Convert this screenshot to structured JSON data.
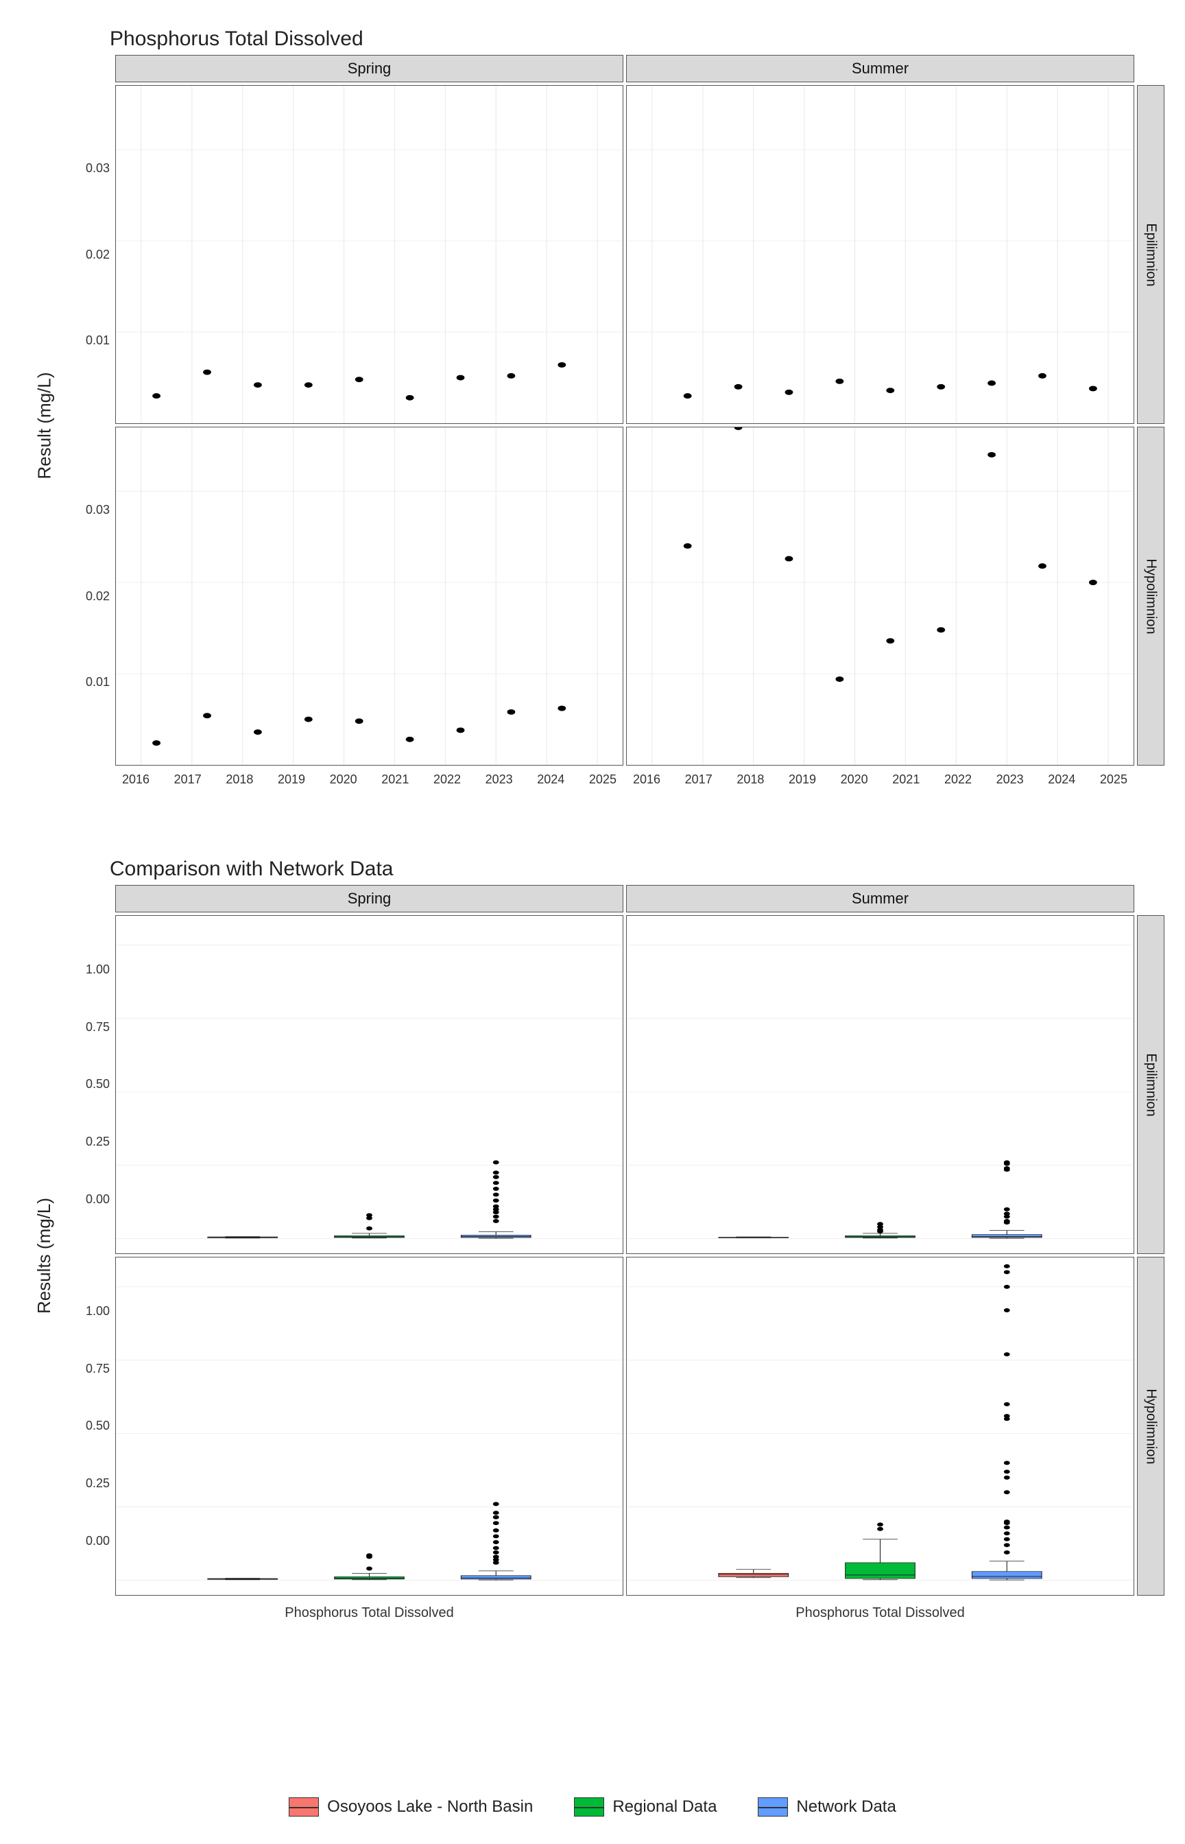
{
  "chart_data": [
    {
      "id": "scatter_grid",
      "type": "scatter",
      "title": "Phosphorus Total Dissolved",
      "ylabel": "Result (mg/L)",
      "xlabel": "",
      "x_range": [
        2015.5,
        2025.5
      ],
      "y_range": [
        0,
        0.037
      ],
      "x_ticks": [
        2016,
        2017,
        2018,
        2019,
        2020,
        2021,
        2022,
        2023,
        2024,
        2025
      ],
      "y_ticks": [
        0.01,
        0.02,
        0.03
      ],
      "facet_cols": [
        "Spring",
        "Summer"
      ],
      "facet_rows": [
        "Epilimnion",
        "Hypolimnion"
      ],
      "panels": {
        "Spring|Epilimnion": [
          {
            "x": 2016.3,
            "y": 0.003
          },
          {
            "x": 2017.3,
            "y": 0.0056
          },
          {
            "x": 2018.3,
            "y": 0.0042
          },
          {
            "x": 2019.3,
            "y": 0.0042
          },
          {
            "x": 2020.3,
            "y": 0.0048
          },
          {
            "x": 2021.3,
            "y": 0.0028
          },
          {
            "x": 2022.3,
            "y": 0.005
          },
          {
            "x": 2023.3,
            "y": 0.0052
          },
          {
            "x": 2024.3,
            "y": 0.0064
          }
        ],
        "Summer|Epilimnion": [
          {
            "x": 2016.7,
            "y": 0.003
          },
          {
            "x": 2017.7,
            "y": 0.004
          },
          {
            "x": 2018.7,
            "y": 0.0034
          },
          {
            "x": 2019.7,
            "y": 0.0046
          },
          {
            "x": 2020.7,
            "y": 0.0036
          },
          {
            "x": 2021.7,
            "y": 0.004
          },
          {
            "x": 2022.7,
            "y": 0.0044
          },
          {
            "x": 2023.7,
            "y": 0.0052
          },
          {
            "x": 2024.7,
            "y": 0.0038
          }
        ],
        "Spring|Hypolimnion": [
          {
            "x": 2016.3,
            "y": 0.0024
          },
          {
            "x": 2017.3,
            "y": 0.0054
          },
          {
            "x": 2018.3,
            "y": 0.0036
          },
          {
            "x": 2019.3,
            "y": 0.005
          },
          {
            "x": 2020.3,
            "y": 0.0048
          },
          {
            "x": 2021.3,
            "y": 0.0028
          },
          {
            "x": 2022.3,
            "y": 0.0038
          },
          {
            "x": 2023.3,
            "y": 0.0058
          },
          {
            "x": 2024.3,
            "y": 0.0062
          }
        ],
        "Summer|Hypolimnion": [
          {
            "x": 2016.7,
            "y": 0.024
          },
          {
            "x": 2017.7,
            "y": 0.037
          },
          {
            "x": 2018.7,
            "y": 0.0226
          },
          {
            "x": 2019.7,
            "y": 0.0094
          },
          {
            "x": 2020.7,
            "y": 0.0136
          },
          {
            "x": 2021.7,
            "y": 0.0148
          },
          {
            "x": 2022.7,
            "y": 0.034
          },
          {
            "x": 2023.7,
            "y": 0.0218
          },
          {
            "x": 2024.7,
            "y": 0.02
          }
        ]
      }
    },
    {
      "id": "box_grid",
      "type": "boxplot",
      "title": "Comparison with Network Data",
      "ylabel": "Results (mg/L)",
      "xlabel": "Phosphorus Total Dissolved",
      "y_range": [
        -0.05,
        1.1
      ],
      "y_ticks": [
        0.0,
        0.25,
        0.5,
        0.75,
        1.0
      ],
      "facet_cols": [
        "Spring",
        "Summer"
      ],
      "facet_rows": [
        "Epilimnion",
        "Hypolimnion"
      ],
      "groups": [
        "Osoyoos Lake - North Basin",
        "Regional Data",
        "Network Data"
      ],
      "group_colors": {
        "Osoyoos Lake - North Basin": "#f8766d",
        "Regional Data": "#00ba38",
        "Network Data": "#619cff"
      },
      "panels": {
        "Spring|Epilimnion": {
          "boxes": [
            {
              "g": "Osoyoos Lake - North Basin",
              "q1": 0.003,
              "med": 0.005,
              "q3": 0.006,
              "lw": 0.002,
              "uw": 0.007
            },
            {
              "g": "Regional Data",
              "q1": 0.004,
              "med": 0.006,
              "q3": 0.01,
              "lw": 0.002,
              "uw": 0.018
            },
            {
              "g": "Network Data",
              "q1": 0.004,
              "med": 0.007,
              "q3": 0.012,
              "lw": 0.001,
              "uw": 0.024
            }
          ],
          "outliers": {
            "Regional Data": [
              0.035,
              0.07,
              0.08
            ],
            "Network Data": [
              0.06,
              0.075,
              0.09,
              0.1,
              0.11,
              0.13,
              0.15,
              0.17,
              0.19,
              0.21,
              0.225,
              0.26
            ]
          }
        },
        "Summer|Epilimnion": {
          "boxes": [
            {
              "g": "Osoyoos Lake - North Basin",
              "q1": 0.003,
              "med": 0.004,
              "q3": 0.005,
              "lw": 0.003,
              "uw": 0.006
            },
            {
              "g": "Regional Data",
              "q1": 0.004,
              "med": 0.006,
              "q3": 0.01,
              "lw": 0.002,
              "uw": 0.018
            },
            {
              "g": "Network Data",
              "q1": 0.004,
              "med": 0.007,
              "q3": 0.014,
              "lw": 0.001,
              "uw": 0.028
            }
          ],
          "outliers": {
            "Regional Data": [
              0.025,
              0.03,
              0.04,
              0.05
            ],
            "Network Data": [
              0.055,
              0.06,
              0.075,
              0.085,
              0.1,
              0.235,
              0.24,
              0.255,
              0.26
            ]
          }
        },
        "Spring|Hypolimnion": {
          "boxes": [
            {
              "g": "Osoyoos Lake - North Basin",
              "q1": 0.003,
              "med": 0.005,
              "q3": 0.006,
              "lw": 0.002,
              "uw": 0.007
            },
            {
              "g": "Regional Data",
              "q1": 0.004,
              "med": 0.007,
              "q3": 0.012,
              "lw": 0.002,
              "uw": 0.024
            },
            {
              "g": "Network Data",
              "q1": 0.004,
              "med": 0.008,
              "q3": 0.016,
              "lw": 0.001,
              "uw": 0.032
            }
          ],
          "outliers": {
            "Regional Data": [
              0.04,
              0.08,
              0.085
            ],
            "Network Data": [
              0.06,
              0.07,
              0.08,
              0.095,
              0.11,
              0.13,
              0.15,
              0.17,
              0.195,
              0.215,
              0.23,
              0.26
            ]
          }
        },
        "Summer|Hypolimnion": {
          "boxes": [
            {
              "g": "Osoyoos Lake - North Basin",
              "q1": 0.012,
              "med": 0.02,
              "q3": 0.024,
              "lw": 0.009,
              "uw": 0.037
            },
            {
              "g": "Regional Data",
              "q1": 0.006,
              "med": 0.018,
              "q3": 0.06,
              "lw": 0.002,
              "uw": 0.14
            },
            {
              "g": "Network Data",
              "q1": 0.006,
              "med": 0.013,
              "q3": 0.03,
              "lw": 0.001,
              "uw": 0.065
            }
          ],
          "outliers": {
            "Regional Data": [
              0.175,
              0.19
            ],
            "Network Data": [
              0.095,
              0.12,
              0.14,
              0.16,
              0.18,
              0.195,
              0.2,
              0.3,
              0.35,
              0.37,
              0.4,
              0.55,
              0.56,
              0.6,
              0.77,
              0.92,
              1.0,
              1.05,
              1.07
            ]
          }
        }
      }
    }
  ],
  "legend": {
    "items": [
      {
        "label": "Osoyoos Lake - North Basin",
        "color": "#f8766d"
      },
      {
        "label": "Regional Data",
        "color": "#00ba38"
      },
      {
        "label": "Network Data",
        "color": "#619cff"
      }
    ]
  }
}
